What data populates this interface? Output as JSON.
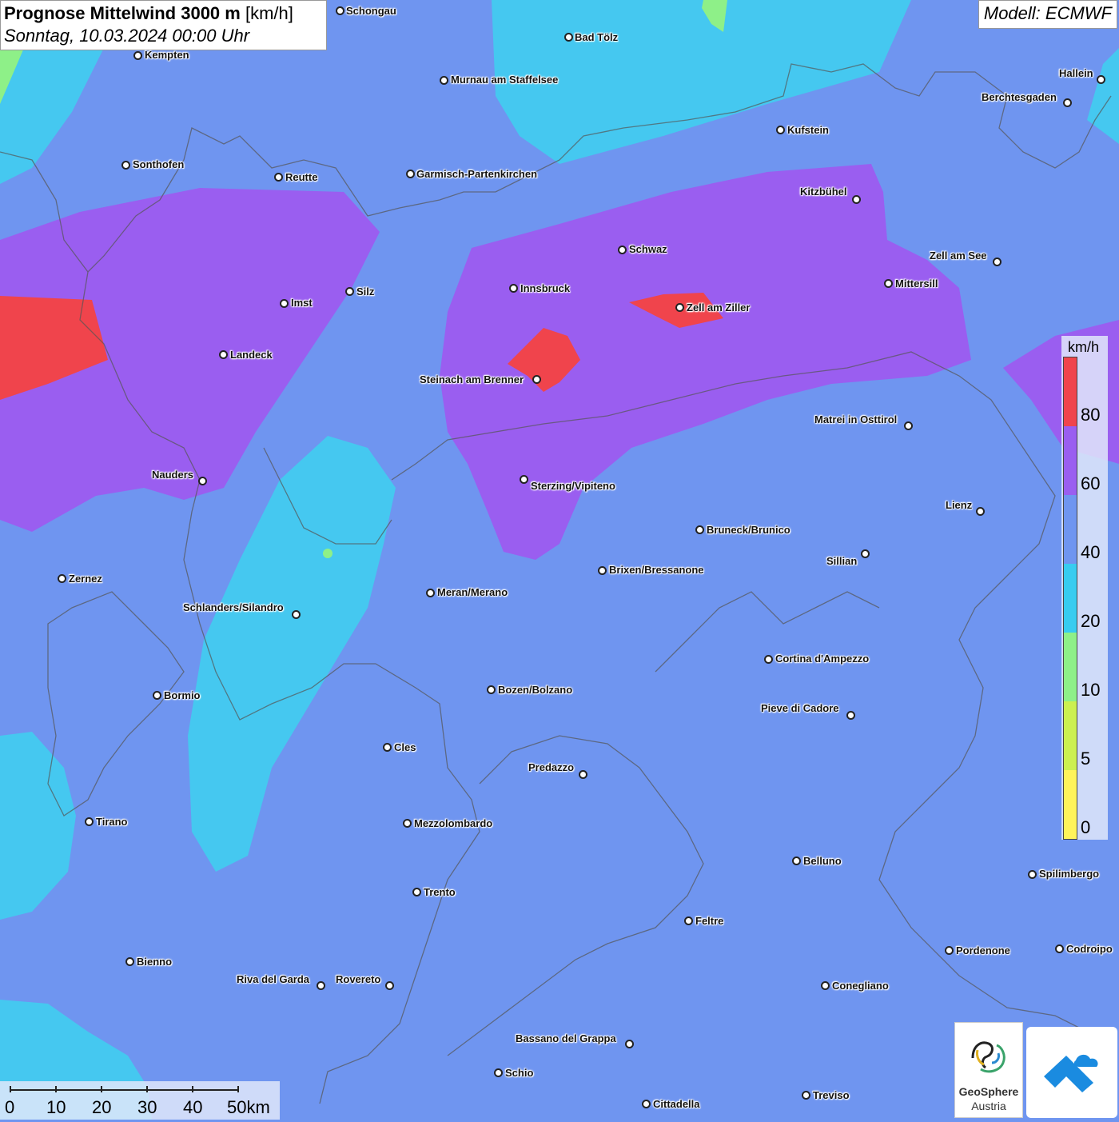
{
  "header": {
    "title_bold": "Prognose Mittelwind 3000 m",
    "title_unit": "[km/h]",
    "subtitle": "Sonntag, 10.03.2024 00:00 Uhr",
    "model": "Modell: ECMWF"
  },
  "legend": {
    "unit": "km/h",
    "ticks": [
      "80",
      "60",
      "40",
      "20",
      "10",
      "5",
      "0"
    ],
    "colors": {
      "80": "#f0444c",
      "60": "#9a5ef0",
      "40": "#6f95f0",
      "20": "#38ccf0",
      "10": "#8ef088",
      "5": "#ccf050",
      "0": "#fff45a"
    }
  },
  "scale": {
    "ticks": [
      "0",
      "10",
      "20",
      "30",
      "40",
      "50km"
    ]
  },
  "logos": {
    "geosphere_line1": "GeoSphere",
    "geosphere_line2": "Austria"
  },
  "cities": [
    "Schongau",
    "Bad Tölz",
    "Kempten",
    "Murnau am Staffelsee",
    "Hallein",
    "Berchtesgaden",
    "Kufstein",
    "Sonthofen",
    "Reutte",
    "Garmisch-Partenkirchen",
    "Kitzbühel",
    "Schwaz",
    "Zell am See",
    "Mittersill",
    "Innsbruck",
    "Imst",
    "Silz",
    "Zell am Ziller",
    "Landeck",
    "Steinach am Brenner",
    "Matrei in Osttirol",
    "Nauders",
    "Sterzing/Vipiteno",
    "Lienz",
    "Bruneck/Brunico",
    "Sillian",
    "Zernez",
    "Brixen/Bressanone",
    "Meran/Merano",
    "Schlanders/Silandro",
    "Cortina d'Ampezzo",
    "Bozen/Bolzano",
    "Bormio",
    "Pieve di Cadore",
    "Cles",
    "Predazzo",
    "Tirano",
    "Mezzolombardo",
    "Belluno",
    "Spilimbergo",
    "Trento",
    "Feltre",
    "Pordenone",
    "Codroipo",
    "Bienno",
    "Riva del Garda",
    "Rovereto",
    "Conegliano",
    "Bassano del Grappa",
    "Schio",
    "Treviso",
    "Cittadella"
  ]
}
